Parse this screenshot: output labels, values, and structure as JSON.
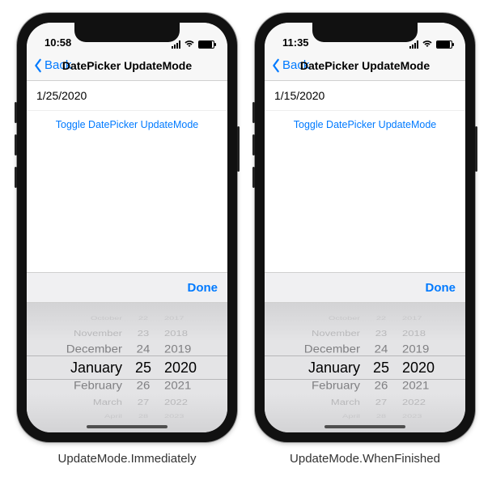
{
  "phones": [
    {
      "time": "10:58",
      "nav": {
        "back": "Back",
        "title": "DatePicker UpdateMode"
      },
      "date_value": "1/25/2020",
      "toggle_label": "Toggle DatePicker UpdateMode",
      "done_label": "Done",
      "picker": {
        "months": [
          "October",
          "November",
          "December",
          "January",
          "February",
          "March",
          "April"
        ],
        "days": [
          "22",
          "23",
          "24",
          "25",
          "26",
          "27",
          "28"
        ],
        "years": [
          "2017",
          "2018",
          "2019",
          "2020",
          "2021",
          "2022",
          "2023"
        ]
      },
      "caption": "UpdateMode.Immediately"
    },
    {
      "time": "11:35",
      "nav": {
        "back": "Back",
        "title": "DatePicker UpdateMode"
      },
      "date_value": "1/15/2020",
      "toggle_label": "Toggle DatePicker UpdateMode",
      "done_label": "Done",
      "picker": {
        "months": [
          "October",
          "November",
          "December",
          "January",
          "February",
          "March",
          "April"
        ],
        "days": [
          "22",
          "23",
          "24",
          "25",
          "26",
          "27",
          "28"
        ],
        "years": [
          "2017",
          "2018",
          "2019",
          "2020",
          "2021",
          "2022",
          "2023"
        ]
      },
      "caption": "UpdateMode.WhenFinished"
    }
  ]
}
